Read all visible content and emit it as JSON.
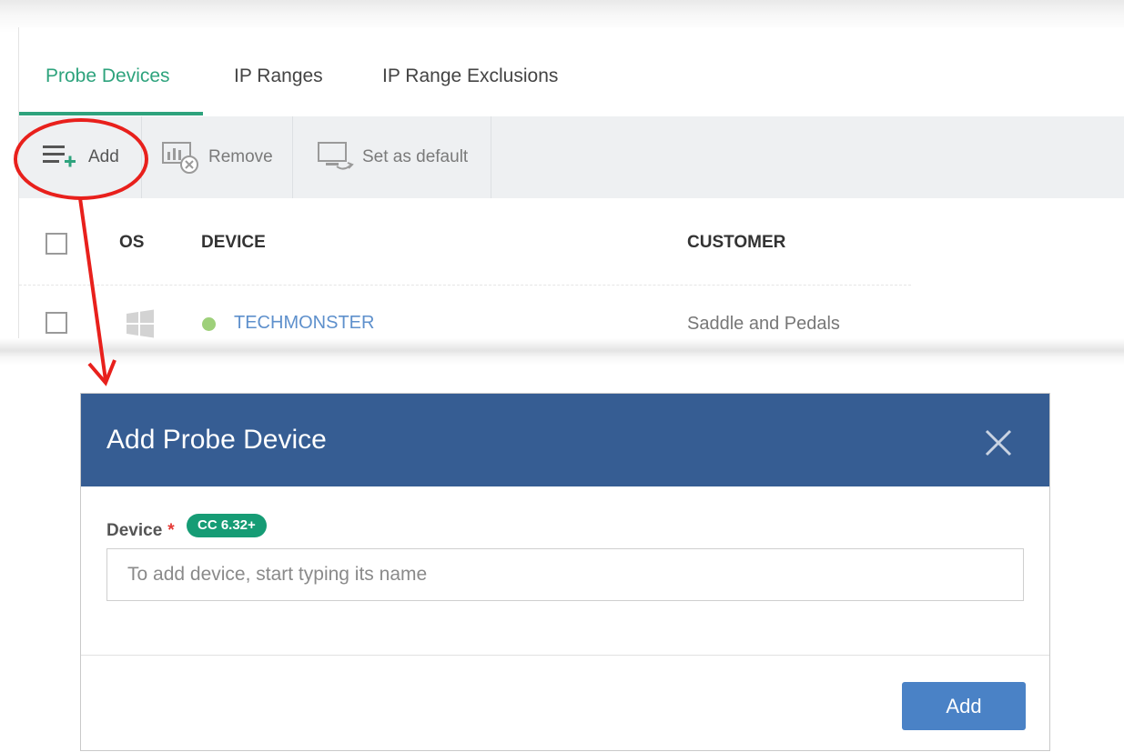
{
  "tabs": [
    {
      "label": "Probe Devices",
      "active": true
    },
    {
      "label": "IP Ranges",
      "active": false
    },
    {
      "label": "IP Range Exclusions",
      "active": false
    }
  ],
  "toolbar": {
    "add_label": "Add",
    "remove_label": "Remove",
    "set_default_label": "Set as default"
  },
  "table": {
    "headers": {
      "os": "OS",
      "device": "DEVICE",
      "customer": "CUSTOMER"
    },
    "rows": [
      {
        "os_icon": "windows-icon",
        "status_color": "#9ed07a",
        "device": "TECHMONSTER",
        "customer": "Saddle and Pedals"
      }
    ]
  },
  "dialog": {
    "title": "Add Probe Device",
    "field_label": "Device",
    "required_mark": "*",
    "version_badge": "CC 6.32+",
    "input_placeholder": "To add device, start typing its name",
    "input_value": "",
    "submit_label": "Add"
  },
  "colors": {
    "accent_green": "#2ea37d",
    "header_blue": "#365d93",
    "button_blue": "#4a82c6",
    "annotation_red": "#e8201c"
  }
}
